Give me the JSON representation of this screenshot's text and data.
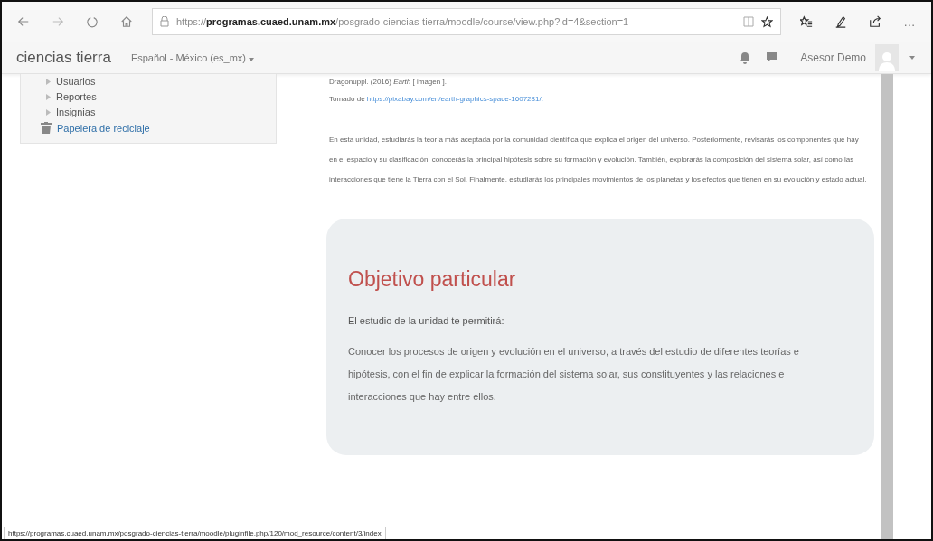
{
  "browser": {
    "address": "https://**programas.cuaed.unam.mx**/posgrado-ciencias-tierra/moodle/course/view.php?id=4&section=1",
    "more": "…"
  },
  "navbar": {
    "brand": "ciencias tierra",
    "language": "Español - México (es_mx)",
    "user": "Asesor Demo"
  },
  "sidebar": {
    "items": [
      {
        "kind": "node",
        "label": "Usuarios"
      },
      {
        "kind": "node",
        "label": "Reportes"
      },
      {
        "kind": "node",
        "label": "Insignias"
      },
      {
        "kind": "trash",
        "label": "Papelera de reciclaje"
      }
    ]
  },
  "content": {
    "citation": "Dragonuppl. (2016) *Earth* [ imagen ].",
    "source_prefix": "Tomado de",
    "source_link": "https://pixabay.com/en/earth-graphics-space-1607281/.",
    "intro": "En esta unidad, estudiarás la teoría más aceptada por la comunidad científica que explica el origen del universo. Posteriormente, revisarás los componentes que hay en el espacio y su clasificación; conocerás la principal hipótesis sobre su formación y evolución. También, explorarás la composición del sistema solar, así como las interacciones que tiene la Tierra con el Sol. Finalmente, estudiarás los principales movimientos de los planetas y los efectos que tienen en su evolución y estado actual.",
    "objective": {
      "title": "Objetivo particular",
      "lead": "El estudio de la unidad te permitirá:",
      "body": "Conocer los procesos de origen y evolución en el universo, a través del estudio de diferentes teorías e hipótesis, con el fin de explicar la formación del sistema solar, sus constituyentes y las relaciones e interacciones que hay entre ellos."
    }
  },
  "status_url": "https://programas.cuaed.unam.mx/posgrado-ciencias-tierra/moodle/pluginfile.php/120/mod_resource/content/3/index"
}
